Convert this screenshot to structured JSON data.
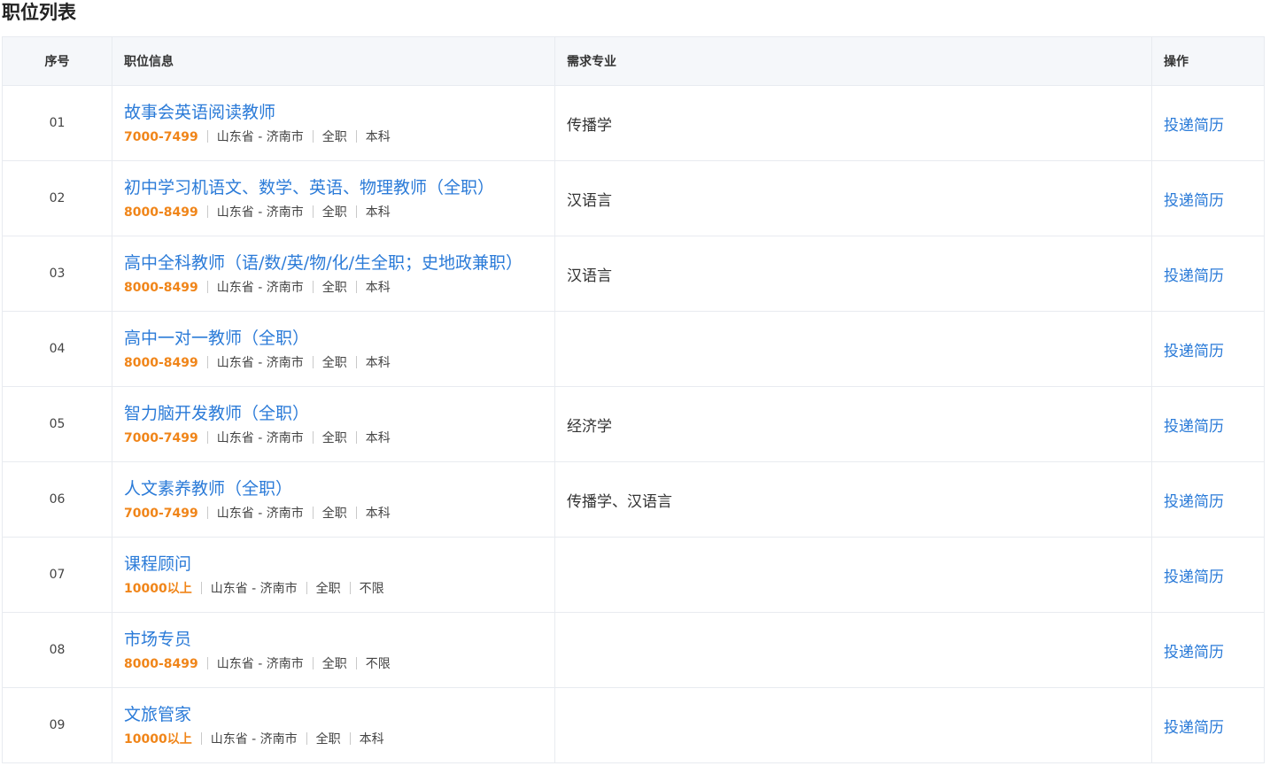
{
  "page": {
    "title": "职位列表"
  },
  "table": {
    "headers": {
      "index": "序号",
      "info": "职位信息",
      "major": "需求专业",
      "action": "操作"
    },
    "rows": [
      {
        "index": "01",
        "title": "故事会英语阅读教师",
        "salary": "7000-7499",
        "location": "山东省 - 济南市",
        "type": "全职",
        "education": "本科",
        "major": "传播学",
        "action": "投递简历"
      },
      {
        "index": "02",
        "title": "初中学习机语文、数学、英语、物理教师（全职）",
        "salary": "8000-8499",
        "location": "山东省 - 济南市",
        "type": "全职",
        "education": "本科",
        "major": "汉语言",
        "action": "投递简历"
      },
      {
        "index": "03",
        "title": "高中全科教师（语/数/英/物/化/生全职；史地政兼职）",
        "salary": "8000-8499",
        "location": "山东省 - 济南市",
        "type": "全职",
        "education": "本科",
        "major": "汉语言",
        "action": "投递简历"
      },
      {
        "index": "04",
        "title": "高中一对一教师（全职）",
        "salary": "8000-8499",
        "location": "山东省 - 济南市",
        "type": "全职",
        "education": "本科",
        "major": "",
        "action": "投递简历"
      },
      {
        "index": "05",
        "title": "智力脑开发教师（全职）",
        "salary": "7000-7499",
        "location": "山东省 - 济南市",
        "type": "全职",
        "education": "本科",
        "major": "经济学",
        "action": "投递简历"
      },
      {
        "index": "06",
        "title": "人文素养教师（全职）",
        "salary": "7000-7499",
        "location": "山东省 - 济南市",
        "type": "全职",
        "education": "本科",
        "major": "传播学、汉语言",
        "action": "投递简历"
      },
      {
        "index": "07",
        "title": "课程顾问",
        "salary": "10000以上",
        "location": "山东省 - 济南市",
        "type": "全职",
        "education": "不限",
        "major": "",
        "action": "投递简历"
      },
      {
        "index": "08",
        "title": "市场专员",
        "salary": "8000-8499",
        "location": "山东省 - 济南市",
        "type": "全职",
        "education": "不限",
        "major": "",
        "action": "投递简历"
      },
      {
        "index": "09",
        "title": "文旅管家",
        "salary": "10000以上",
        "location": "山东省 - 济南市",
        "type": "全职",
        "education": "本科",
        "major": "",
        "action": "投递简历"
      }
    ]
  },
  "colors": {
    "link": "#2b7bd8",
    "salary": "#f08519",
    "header_bg": "#f5f7fa",
    "border": "#e8ebf0"
  }
}
